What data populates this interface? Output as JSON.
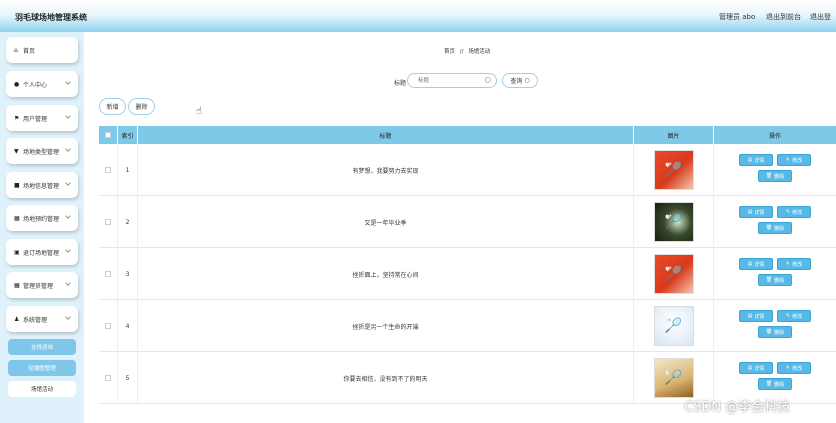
{
  "header": {
    "app_title": "羽毛球场地管理系统",
    "admin_label": "管理员 abo",
    "back_frontend": "退出到前台",
    "logout": "退出登"
  },
  "sidebar": {
    "items": [
      {
        "label": "首页",
        "icon": "home-icon"
      },
      {
        "label": "个人中心",
        "icon": "person-icon"
      },
      {
        "label": "用户管理",
        "icon": "flag-icon"
      },
      {
        "label": "场地类型管理",
        "icon": "pin-icon"
      },
      {
        "label": "场地信息管理",
        "icon": "doc-icon"
      },
      {
        "label": "场地预约管理",
        "icon": "grid-icon"
      },
      {
        "label": "退订场地管理",
        "icon": "lock-icon"
      },
      {
        "label": "管理员管理",
        "icon": "grid-icon"
      },
      {
        "label": "系统管理",
        "icon": "person-icon"
      }
    ],
    "sub_items": [
      {
        "label": "在线咨询"
      },
      {
        "label": "轮播图管理"
      },
      {
        "label": "场馆活动"
      }
    ]
  },
  "breadcrumb": {
    "home": "首页",
    "sep": "//",
    "current": "场馆活动"
  },
  "search": {
    "label": "标题",
    "placeholder": "标题",
    "button": "查询"
  },
  "actions": {
    "add": "新增",
    "delete": "删除"
  },
  "table": {
    "headers": {
      "index": "索引",
      "title": "标题",
      "image": "图片",
      "ops": "操作"
    },
    "rows": [
      {
        "index": "1",
        "title": "有梦想，我要努力去实现",
        "img": "red"
      },
      {
        "index": "2",
        "title": "又是一年毕业季",
        "img": "dark"
      },
      {
        "index": "3",
        "title": "挫折面上，坚持常在心间",
        "img": "red"
      },
      {
        "index": "4",
        "title": "挫折是另一个生命的开端",
        "img": "shuttle"
      },
      {
        "index": "5",
        "title": "你要去相信，没有到不了的明天",
        "img": "court"
      }
    ],
    "op_labels": {
      "detail": "详情",
      "edit": "修改",
      "delete": "删除"
    }
  },
  "watermark": "CSDN @李会科技",
  "colors": {
    "accent": "#58b9e6",
    "header": "#7ec8e8",
    "sidebar_bg": "#dff1fa"
  }
}
